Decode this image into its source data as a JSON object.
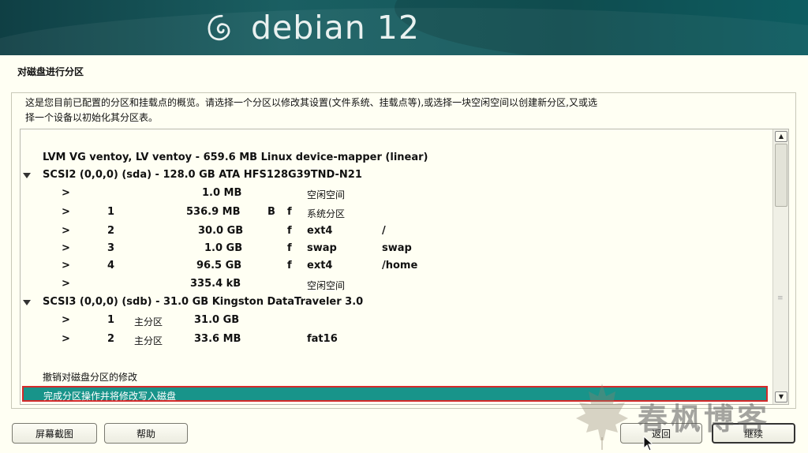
{
  "header": {
    "brand": "debian 12"
  },
  "page": {
    "title": "对磁盘进行分区",
    "description_line1": "这是您目前已配置的分区和挂载点的概览。请选择一个分区以修改其设置(文件系统、挂载点等),或选择一块空闲空间以创建新分区,又或选",
    "description_line2": "择一个设备以初始化其分区表。"
  },
  "partition_list": {
    "lvm_row": "LVM VG ventoy, LV ventoy - 659.6 MB Linux device-mapper (linear)",
    "disk1": {
      "label": "SCSI2 (0,0,0) (sda) - 128.0 GB ATA HFS128G39TND-N21",
      "rows": [
        {
          "arrow": ">",
          "num": "",
          "size": "1.0 MB",
          "flag1": "",
          "flag2": "",
          "fs": "空闲空间",
          "mount": ""
        },
        {
          "arrow": ">",
          "num": "1",
          "size": "536.9 MB",
          "flag1": "B",
          "flag2": "f",
          "fs": "系统分区",
          "mount": ""
        },
        {
          "arrow": ">",
          "num": "2",
          "size": "30.0 GB",
          "flag1": "",
          "flag2": "f",
          "fs": "ext4",
          "mount": "/"
        },
        {
          "arrow": ">",
          "num": "3",
          "size": "1.0 GB",
          "flag1": "",
          "flag2": "f",
          "fs": "swap",
          "mount": "swap"
        },
        {
          "arrow": ">",
          "num": "4",
          "size": "96.5 GB",
          "flag1": "",
          "flag2": "f",
          "fs": "ext4",
          "mount": "/home"
        },
        {
          "arrow": ">",
          "num": "",
          "size": "335.4 kB",
          "flag1": "",
          "flag2": "",
          "fs": "空闲空间",
          "mount": ""
        }
      ]
    },
    "disk2": {
      "label": "SCSI3 (0,0,0) (sdb) - 31.0 GB Kingston DataTraveler 3.0",
      "rows": [
        {
          "arrow": ">",
          "num": "1",
          "type": "主分区",
          "size": "31.0 GB",
          "fs": ""
        },
        {
          "arrow": ">",
          "num": "2",
          "type": "主分区",
          "size": "33.6 MB",
          "fs": "fat16"
        }
      ]
    },
    "undo_label": "撤销对磁盘分区的修改",
    "finish_label": "完成分区操作并将修改写入磁盘"
  },
  "buttons": {
    "screenshot": "屏幕截图",
    "help": "帮助",
    "back": "返回",
    "continue": "继续"
  },
  "watermark": {
    "text": "春枫博客"
  },
  "colors": {
    "banner": "#12575a",
    "selection": "#18948a",
    "selection_border": "#d42a2a",
    "background": "#fffff3"
  }
}
